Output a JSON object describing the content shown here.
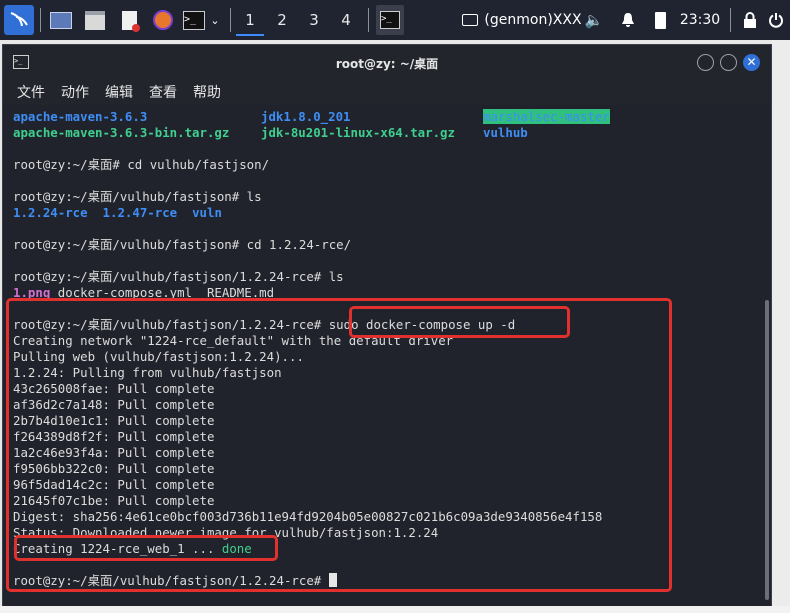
{
  "panel": {
    "workspaces": [
      "1",
      "2",
      "3",
      "4"
    ],
    "genmon": "(genmon)XXX",
    "clock": "23:30"
  },
  "window": {
    "title": "root@zy: ~/桌面",
    "menu": [
      "文件",
      "动作",
      "编辑",
      "查看",
      "帮助"
    ]
  },
  "terminal": {
    "ls1_col1": [
      "apache-maven-3.6.3",
      "apache-maven-3.6.3-bin.tar.gz"
    ],
    "ls1_col2": [
      "jdk1.8.0_201",
      "jdk-8u201-linux-x64.tar.gz"
    ],
    "ls1_col3": [
      "marshalsec-master",
      "vulhub"
    ],
    "cmd1_prompt": "root@zy:~/桌面# ",
    "cmd1": "cd vulhub/fastjson/",
    "cmd2_prompt": "root@zy:~/桌面/vulhub/fastjson# ",
    "cmd2": "ls",
    "ls2": [
      "1.2.24-rce",
      "1.2.47-rce",
      "vuln"
    ],
    "cmd3_prompt": "root@zy:~/桌面/vulhub/fastjson# ",
    "cmd3": "cd 1.2.24-rce/",
    "cmd4_prompt": "root@zy:~/桌面/vulhub/fastjson/1.2.24-rce# ",
    "cmd4": "ls",
    "ls3_png": "1.png",
    "ls3_rest": " docker-compose.yml  README.md",
    "cmd5_prompt": "root@zy:~/桌面/vulhub/fastjson/1.2.24-rce# ",
    "cmd5": "sudo docker-compose up -d",
    "output": [
      "Creating network \"1224-rce_default\" with the default driver",
      "Pulling web (vulhub/fastjson:1.2.24)...",
      "1.2.24: Pulling from vulhub/fastjson",
      "43c265008fae: Pull complete",
      "af36d2c7a148: Pull complete",
      "2b7b4d10e1c1: Pull complete",
      "f264389d8f2f: Pull complete",
      "1a2c46e93f4a: Pull complete",
      "f9506bb322c0: Pull complete",
      "96f5dad14c2c: Pull complete",
      "21645f07c1be: Pull complete",
      "Digest: sha256:4e61ce0bcf003d736b11e94fd9204b05e00827c021b6c09a3de9340856e4f158",
      "Status: Downloaded newer image for vulhub/fastjson:1.2.24"
    ],
    "creating": "Creating 1224-rce_web_1 ... ",
    "creating_status": "done",
    "final_prompt": "root@zy:~/桌面/vulhub/fastjson/1.2.24-rce# "
  }
}
